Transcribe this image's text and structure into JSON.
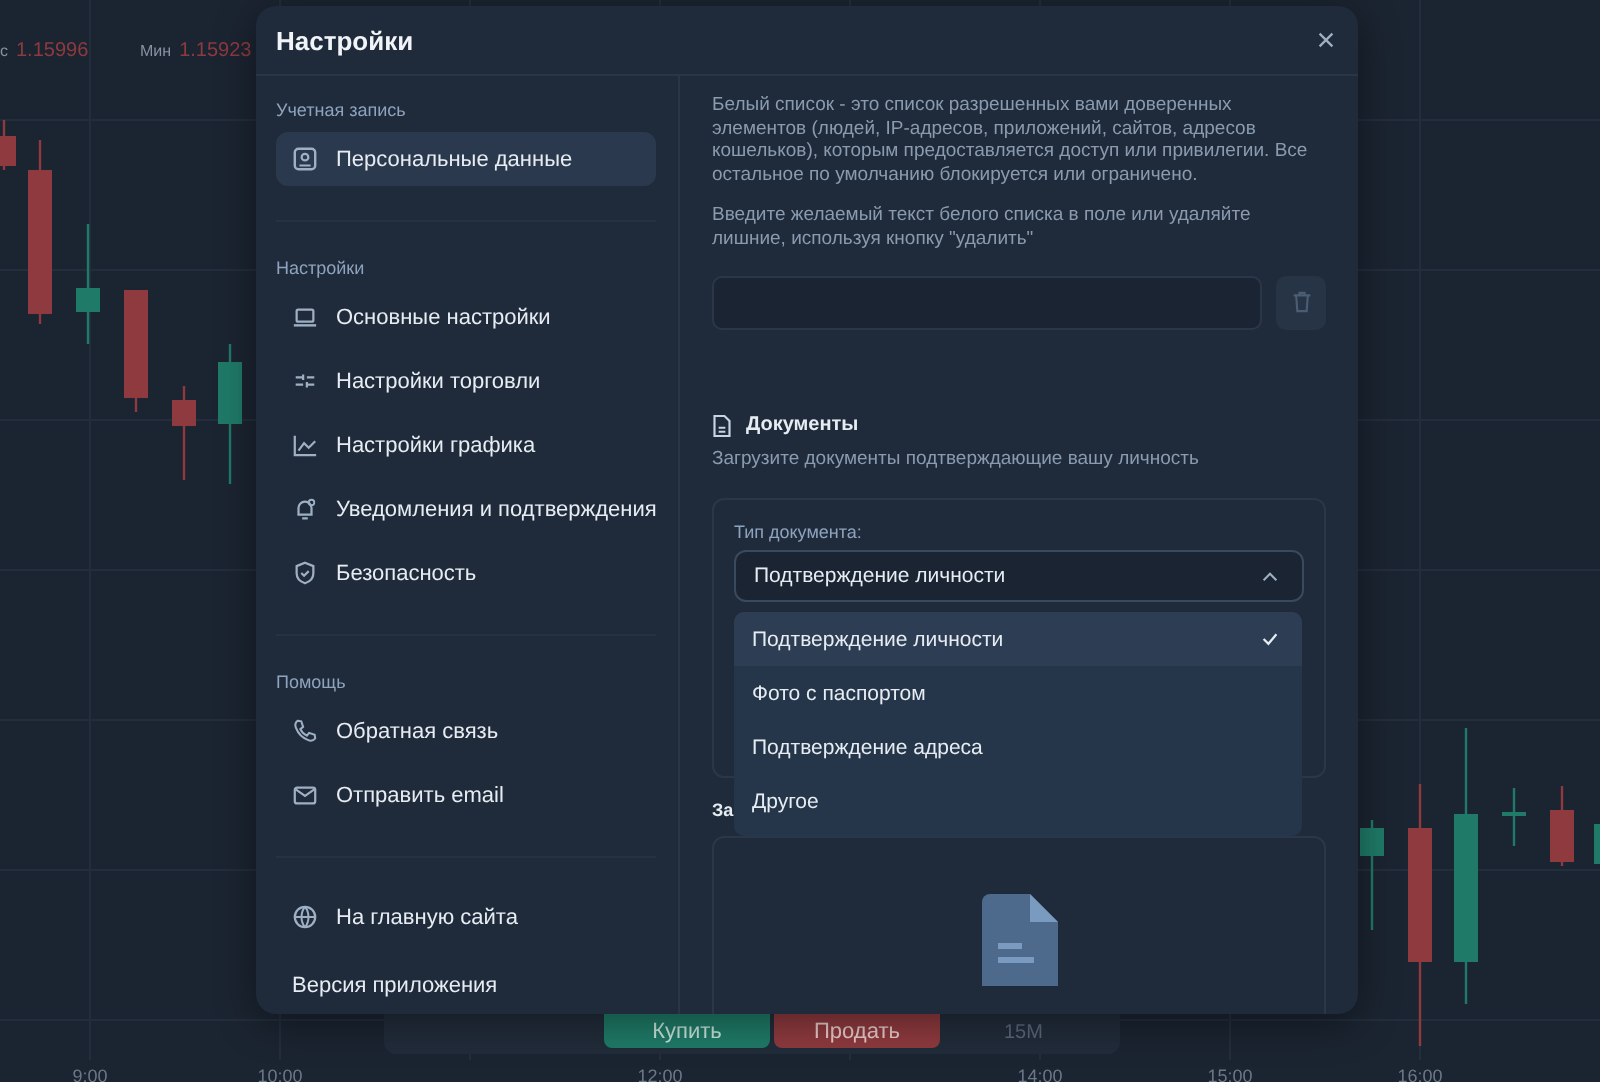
{
  "chart": {
    "stats": [
      {
        "label": "с",
        "value": "1.15996"
      },
      {
        "label": "Мин",
        "value": "1.15923"
      }
    ],
    "time_labels": [
      "9:00",
      "10:00",
      "12:00",
      "14:00",
      "15:00",
      "16:00"
    ],
    "toolbar": {
      "buy": "Купить",
      "sell": "Продать",
      "timeframe": "15M"
    }
  },
  "dialog": {
    "title": "Настройки",
    "sidebar": {
      "sections": [
        {
          "title": "Учетная запись",
          "items": [
            {
              "label": "Персональные данные",
              "selected": true
            }
          ]
        },
        {
          "title": "Настройки",
          "items": [
            {
              "label": "Основные настройки",
              "selected": false
            },
            {
              "label": "Настройки торговли",
              "selected": false
            },
            {
              "label": "Настройки графика",
              "selected": false
            },
            {
              "label": "Уведомления и подтверждения",
              "selected": false
            },
            {
              "label": "Безопасность",
              "selected": false
            }
          ]
        },
        {
          "title": "Помощь",
          "items": [
            {
              "label": "Обратная связь",
              "selected": false
            },
            {
              "label": "Отправить email",
              "selected": false
            }
          ]
        }
      ],
      "home_link": "На главную сайта",
      "version_label": "Версия приложения"
    },
    "whitelist": {
      "description": "Белый список - это список разрешенных вами доверенных элементов (людей, IP-адресов, приложений, сайтов, адресов кошельков), которым предоставляется доступ или привилегии. Все остальное по умолчанию блокируется или ограничено.",
      "instruction": "Введите желаемый текст белого списка в поле или удаляйте лишние, используя кнопку \"удалить\""
    },
    "documents": {
      "title": "Документы",
      "subtitle": "Загрузите документы подтверждающие вашу личность",
      "type_label": "Тип документа:",
      "select": {
        "value": "Подтверждение личности",
        "expanded": true,
        "options": [
          {
            "label": "Подтверждение личности",
            "selected": true
          },
          {
            "label": "Фото с паспортом",
            "selected": false
          },
          {
            "label": "Подтверждение адреса",
            "selected": false
          },
          {
            "label": "Другое",
            "selected": false
          }
        ]
      },
      "upload_title": "За"
    }
  }
}
